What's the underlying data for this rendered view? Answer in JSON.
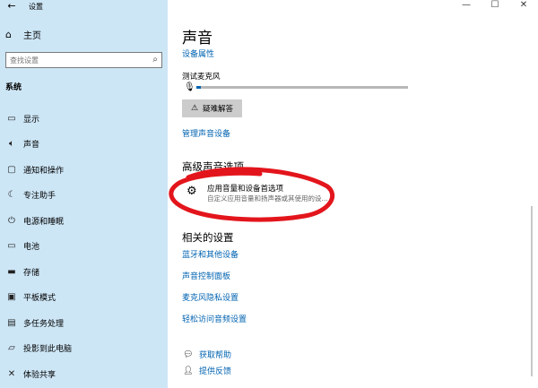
{
  "window": {
    "back_glyph": "←",
    "title": "设置",
    "minimize_glyph": "—",
    "maximize_glyph": "☐",
    "close_glyph": "✕"
  },
  "sidebar": {
    "home": {
      "icon": "home-icon",
      "label": "主页"
    },
    "search": {
      "placeholder": "查找设置",
      "icon": "search-icon"
    },
    "section": "系统",
    "items": [
      {
        "icon": "display-icon",
        "label": "显示"
      },
      {
        "icon": "speaker-icon",
        "label": "声音"
      },
      {
        "icon": "notification-icon",
        "label": "通知和操作"
      },
      {
        "icon": "moon-icon",
        "label": "专注助手"
      },
      {
        "icon": "power-icon",
        "label": "电源和睡眠"
      },
      {
        "icon": "battery-icon",
        "label": "电池"
      },
      {
        "icon": "storage-icon",
        "label": "存储"
      },
      {
        "icon": "tablet-icon",
        "label": "平板模式"
      },
      {
        "icon": "multitask-icon",
        "label": "多任务处理"
      },
      {
        "icon": "project-icon",
        "label": "投影到此电脑"
      },
      {
        "icon": "share-icon",
        "label": "体验共享"
      }
    ]
  },
  "main": {
    "title": "声音",
    "device_properties_link": "设备属性",
    "mic_test_label": "测试麦克风",
    "mic_level_fraction": 0.02,
    "troubleshoot_button": "疑难解答",
    "manage_devices_link": "管理声音设备",
    "advanced_heading": "高级声音选项",
    "app_volume_option": {
      "title": "应用音量和设备首选项",
      "description": "自定义应用音量和扬声器或其使用的设..."
    },
    "related_heading": "相关的设置",
    "related_links": [
      "蓝牙和其他设备",
      "声音控制面板",
      "麦克风隐私设置",
      "轻松访问音频设置"
    ],
    "help": [
      {
        "icon": "help-chat-icon",
        "label": "获取帮助"
      },
      {
        "icon": "feedback-icon",
        "label": "提供反馈"
      }
    ]
  },
  "colors": {
    "sidebar_bg": "#cde6f6",
    "link": "#0063b1",
    "annotation": "#e3151c",
    "button_bg": "#cccccc"
  }
}
